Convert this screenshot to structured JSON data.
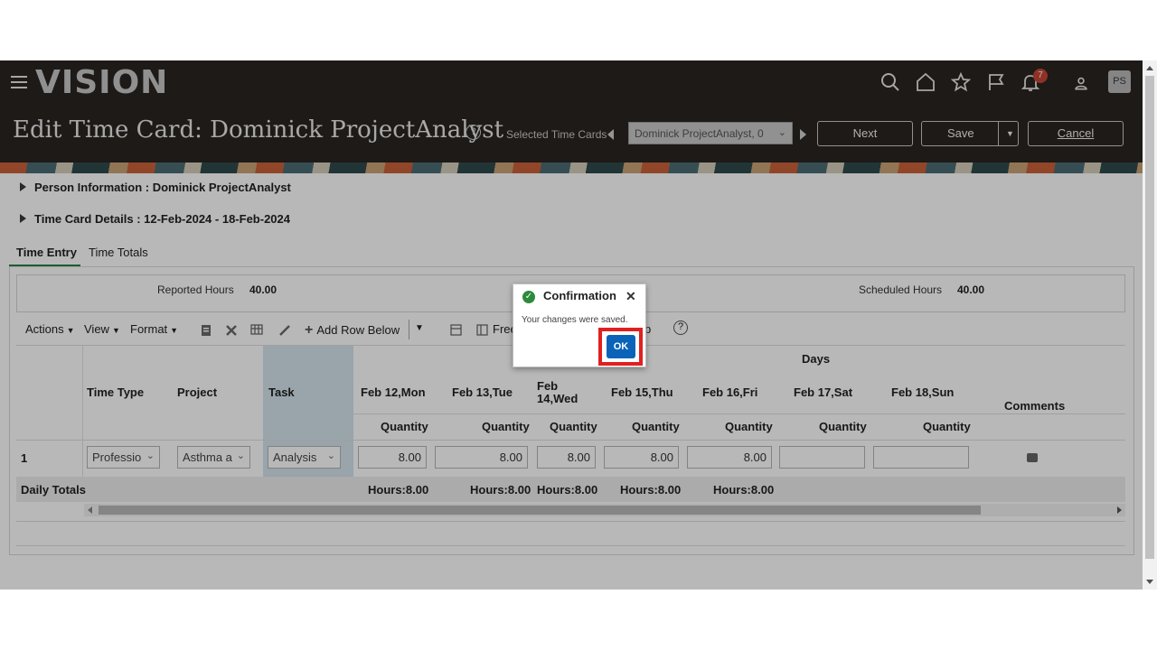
{
  "header": {
    "logo": "VISION",
    "notification_count": "7",
    "avatar_initials": "PS",
    "page_title": "Edit Time Card: Dominick ProjectAnalyst",
    "help_glyph": "?",
    "selected_time_cards_label": "Selected Time Cards",
    "selected_time_card_value": "Dominick ProjectAnalyst, 0",
    "next_label": "Next",
    "save_label": "Save",
    "cancel_label": "Cancel",
    "icons": [
      "hamburger-icon",
      "search-icon",
      "home-icon",
      "star-icon",
      "flag-icon",
      "bell-icon",
      "user-icon"
    ]
  },
  "sections": {
    "person_info": "Person Information : Dominick ProjectAnalyst",
    "time_card_details": "Time Card Details : 12-Feb-2024 - 18-Feb-2024"
  },
  "tabs": [
    {
      "label": "Time Entry",
      "active": true
    },
    {
      "label": "Time Totals",
      "active": false
    }
  ],
  "summary": {
    "reported_hours_label": "Reported Hours",
    "reported_hours_value": "40.00",
    "scheduled_hours_label": "Scheduled Hours",
    "scheduled_hours_value": "40.00"
  },
  "toolbar": {
    "actions": "Actions",
    "view": "View",
    "format": "Format",
    "add_row_below": "Add Row Below",
    "freeze_partial": "Free",
    "help_partial": "p"
  },
  "table": {
    "group_header": "Days",
    "columns": {
      "time_type": "Time Type",
      "project": "Project",
      "task": "Task",
      "comments": "Comments"
    },
    "days": [
      "Feb 12,Mon",
      "Feb 13,Tue",
      "Feb 14,Wed",
      "Feb 15,Thu",
      "Feb 16,Fri",
      "Feb 17,Sat",
      "Feb 18,Sun"
    ],
    "quantity_label": "Quantity",
    "row": {
      "number": "1",
      "time_type": "Professio",
      "project": "Asthma a",
      "task": "Analysis",
      "quantities": [
        "8.00",
        "8.00",
        "8.00",
        "8.00",
        "8.00",
        "",
        ""
      ]
    },
    "daily_totals_label": "Daily Totals",
    "daily_totals": [
      "Hours:8.00",
      "Hours:8.00",
      "Hours:8.00",
      "Hours:8.00",
      "Hours:8.00"
    ]
  },
  "dialog": {
    "title": "Confirmation",
    "message": "Your changes were saved.",
    "ok_label": "OK",
    "close_glyph": "✕",
    "check_glyph": "✓"
  },
  "colors": {
    "header_bg": "#2a2521",
    "ok_button": "#0a63b8",
    "highlight": "#e02020",
    "success": "#2d8a3c"
  }
}
